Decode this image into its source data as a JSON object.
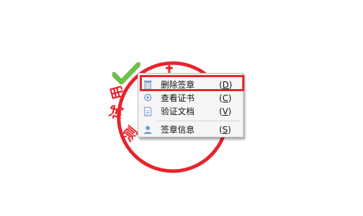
{
  "seal": {
    "text_chars": [
      "测",
      "试",
      "用"
    ],
    "accent_color": "#e8242b",
    "check_color": "#6cc04a"
  },
  "context_menu": {
    "items": [
      {
        "label": "删除签章",
        "shortcut_prefix": "(",
        "shortcut_key": "D",
        "shortcut_suffix": ")",
        "icon": "trash-icon"
      },
      {
        "label": "查看证书",
        "shortcut_prefix": "(",
        "shortcut_key": "C",
        "shortcut_suffix": ")",
        "icon": "certificate-icon"
      },
      {
        "label": "验证文档",
        "shortcut_prefix": "(",
        "shortcut_key": "V",
        "shortcut_suffix": ")",
        "icon": "document-icon"
      },
      {
        "label": "签章信息",
        "shortcut_prefix": "(",
        "shortcut_key": "S",
        "shortcut_suffix": ")",
        "icon": "user-info-icon"
      }
    ]
  }
}
